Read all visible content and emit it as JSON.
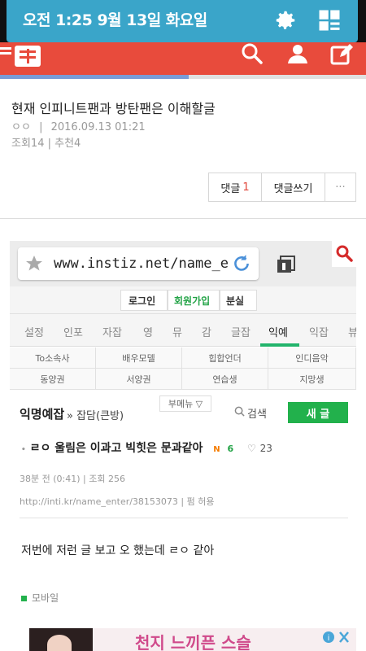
{
  "status_bar": {
    "time": "오전 1:25 9월 13일 화요일"
  },
  "post": {
    "title": "현재 인피니트팬과 방탄팬은 이해할글",
    "author": "ㅇㅇ",
    "date": "2016.09.13 01:21",
    "stats": "조회14 | 추천4",
    "comment_label": "댓글",
    "comment_count": "1",
    "write_comment_label": "댓글쓰기",
    "more_label": "···"
  },
  "embedded": {
    "url": "www.instiz.net/name_er",
    "login": "로그인",
    "signup": "회원가입",
    "lost": "분실",
    "nav": [
      "설정",
      "인포",
      "자잡",
      "영",
      "뮤",
      "감",
      "글잡",
      "익예",
      "익잡",
      "뷰"
    ],
    "categories": [
      [
        "To소속사",
        "배우모델",
        "힙합언더",
        "인디음악"
      ],
      [
        "동양권",
        "서양권",
        "연습생",
        "지망생"
      ]
    ],
    "board_title": "익명예잡",
    "board_sub": "» 잡담(큰방)",
    "sub_menu": "부메뉴 ▽",
    "search_label": "검색",
    "new_post": "새 글",
    "post_title": "ㄹㅇ 울림은 이과고 빅힛은 문과같아",
    "post_comments": "6",
    "post_likes": "23",
    "post_meta1": "38분 전 (0:41) | 조회 256",
    "post_meta2": "http://inti.kr/name_enter/38153073 | 펌 허용",
    "post_body": "저번에 저런 글 보고 오 했는데 ㄹㅇ 같아",
    "mobile_label": "모바일",
    "ad_text": "천지 느끼픈 스슬"
  },
  "colors": {
    "shade": "#3aa5c9",
    "brand_red": "#e84b3c",
    "green": "#22b14c"
  }
}
